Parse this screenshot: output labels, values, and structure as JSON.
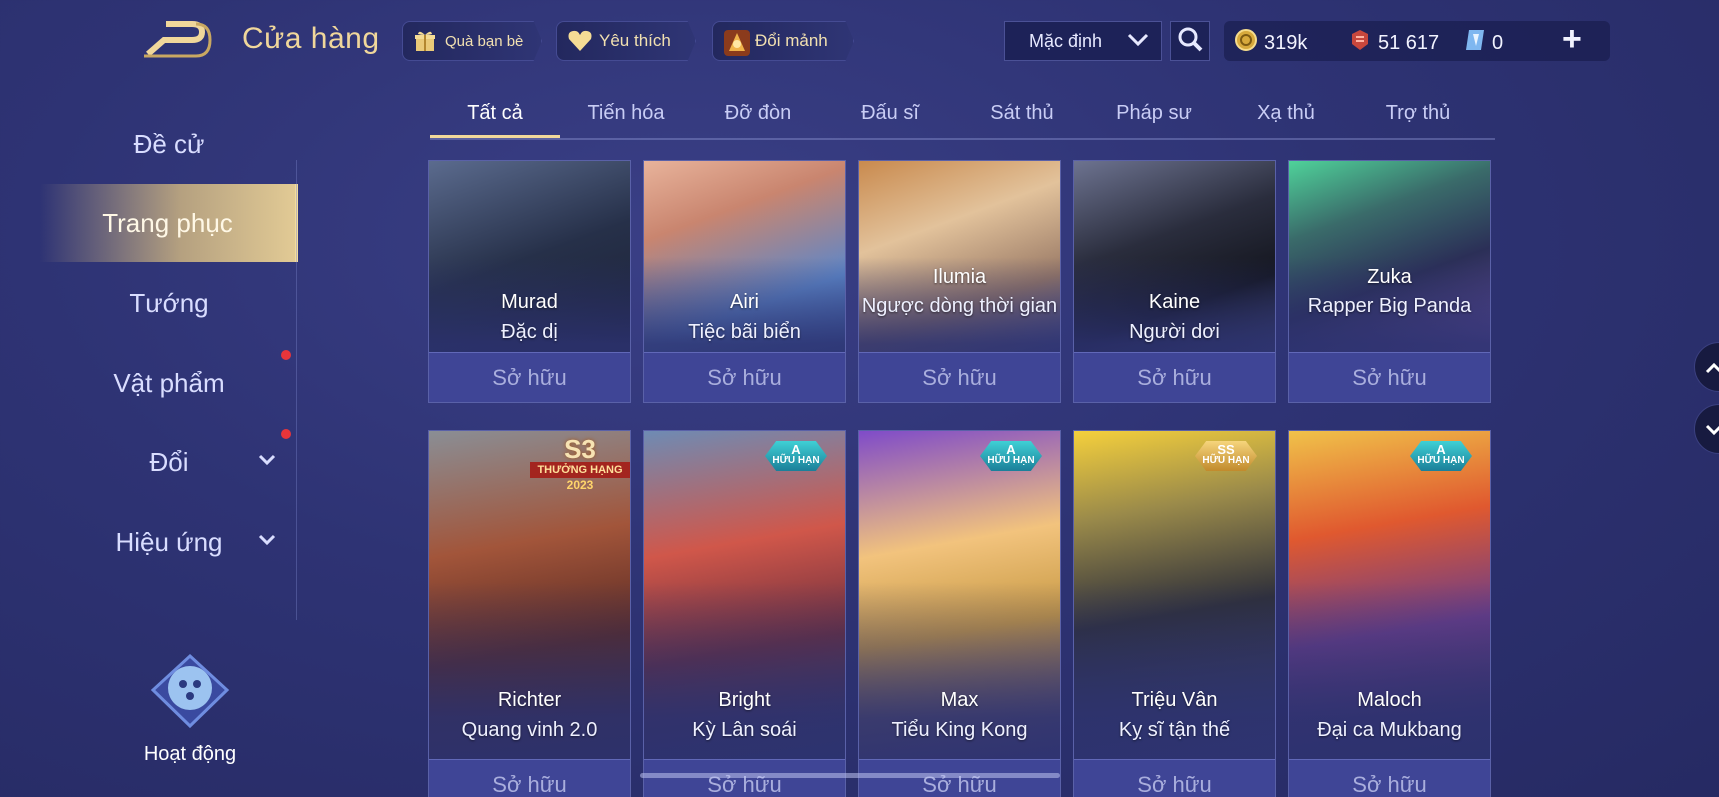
{
  "header": {
    "title": "Cửa hàng",
    "pills": [
      {
        "label": "Quà bạn bè",
        "icon": "gift-icon"
      },
      {
        "label": "Yêu thích",
        "icon": "heart-icon"
      },
      {
        "label": "Đổi mảnh",
        "icon": "shard-exchange-icon"
      }
    ],
    "sort": {
      "value": "Mặc định"
    },
    "currencies": [
      {
        "icon": "gold-coin-icon",
        "value": "319k"
      },
      {
        "icon": "voucher-icon",
        "value": "51 617"
      },
      {
        "icon": "diamond-icon",
        "value": "0"
      }
    ],
    "plus": "+"
  },
  "sidebar": {
    "items": [
      {
        "label": "Đề cử"
      },
      {
        "label": "Trang phục"
      },
      {
        "label": "Tướng"
      },
      {
        "label": "Vật phẩm"
      },
      {
        "label": "Đổi"
      },
      {
        "label": "Hiệu ứng"
      }
    ],
    "activity": "Hoạt động"
  },
  "tabs": [
    "Tất cả",
    "Tiến hóa",
    "Đỡ đòn",
    "Đấu sĩ",
    "Sát thủ",
    "Pháp sư",
    "Xạ thủ",
    "Trợ thủ"
  ],
  "cards_row1": [
    {
      "hero": "Murad",
      "skin": "Đặc dị",
      "status": "Sở hữu"
    },
    {
      "hero": "Airi",
      "skin": "Tiệc bãi biển",
      "status": "Sở hữu"
    },
    {
      "hero": "Ilumia",
      "skin": "Ngược dòng thời gian",
      "status": "Sở hữu"
    },
    {
      "hero": "Kaine",
      "skin": "Người dơi",
      "status": "Sở hữu"
    },
    {
      "hero": "Zuka",
      "skin": "Rapper Big Panda",
      "status": "Sở hữu"
    }
  ],
  "cards_row2": [
    {
      "hero": "Richter",
      "skin": "Quang vinh 2.0",
      "status": "Sở hữu",
      "badge_top": "S3",
      "badge_mid": "THƯỞNG HẠNG",
      "badge_bottom": "2023"
    },
    {
      "hero": "Bright",
      "skin": "Kỳ Lân soái",
      "status": "Sở hữu",
      "badge_top": "A",
      "badge_bottom": "HỮU HẠN"
    },
    {
      "hero": "Max",
      "skin": "Tiểu King Kong",
      "status": "Sở hữu",
      "badge_top": "A",
      "badge_bottom": "HỮU HẠN"
    },
    {
      "hero": "Triệu Vân",
      "skin": "Kỵ sĩ tận thế",
      "status": "Sở hữu",
      "badge_top": "SS",
      "badge_bottom": "HỮU HẠN"
    },
    {
      "hero": "Maloch",
      "skin": "Đại ca Mukbang",
      "status": "Sở hữu",
      "badge_top": "A",
      "badge_bottom": "HỮU HẠN"
    }
  ],
  "colors": {
    "accent_gold": "#f0d79b",
    "notification_red": "#e8353a",
    "panel": "#3f4596"
  }
}
